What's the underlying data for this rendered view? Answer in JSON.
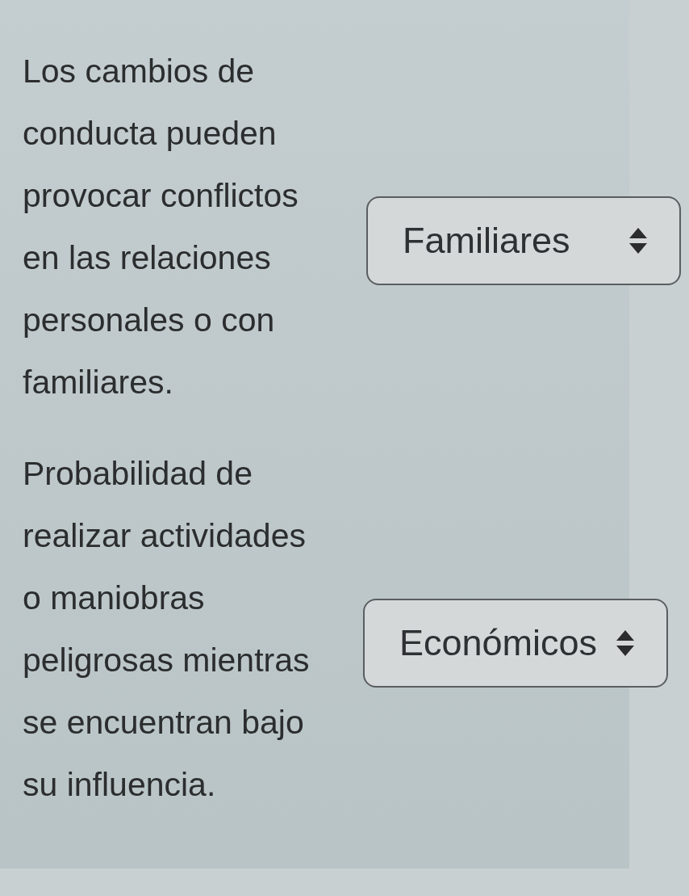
{
  "items": [
    {
      "text": "Los cambios de conducta pueden provocar conflictos en las relaciones personales o con familiares.",
      "select": {
        "value": "Familiares"
      }
    },
    {
      "text": "Probabilidad de realizar actividades o maniobras peligrosas mientras se encuentran bajo su influencia.",
      "select": {
        "value": "Económicos"
      }
    }
  ]
}
